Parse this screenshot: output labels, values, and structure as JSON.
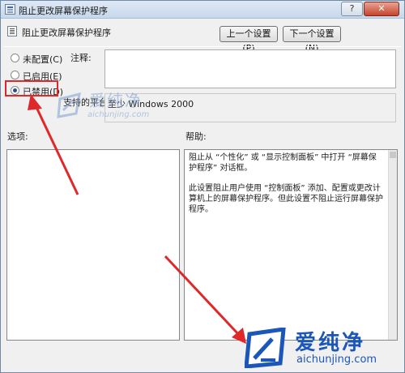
{
  "window": {
    "title": "阻止更改屏幕保护程序",
    "help_button": "?",
    "close_button": "✕"
  },
  "header": {
    "setting_name": "阻止更改屏幕保护程序",
    "prev_button": "上一个设置(P)",
    "next_button": "下一个设置(N)"
  },
  "state_options": [
    {
      "label": "未配置(C)",
      "checked": false
    },
    {
      "label": "已启用(E)",
      "checked": false
    },
    {
      "label": "已禁用(D)",
      "checked": true
    }
  ],
  "comment": {
    "label": "注释:",
    "value": ""
  },
  "platform": {
    "label": "支持的平台:",
    "value": "至少 Windows 2000"
  },
  "options_label": "选项:",
  "help": {
    "label": "帮助:",
    "paragraphs": [
      "阻止从 “个性化” 或 “显示控制面板” 中打开 “屏幕保护程序” 对话框。",
      "此设置阻止用户使用 “控制面板” 添加、配置或更改计算机上的屏幕保护程序。但此设置不阻止运行屏幕保护程序。"
    ]
  },
  "watermark": {
    "cn": "爱纯净",
    "en": "aichunjing.com"
  },
  "colors": {
    "highlight": "#e0282a",
    "watermark": "#1b57b8"
  }
}
